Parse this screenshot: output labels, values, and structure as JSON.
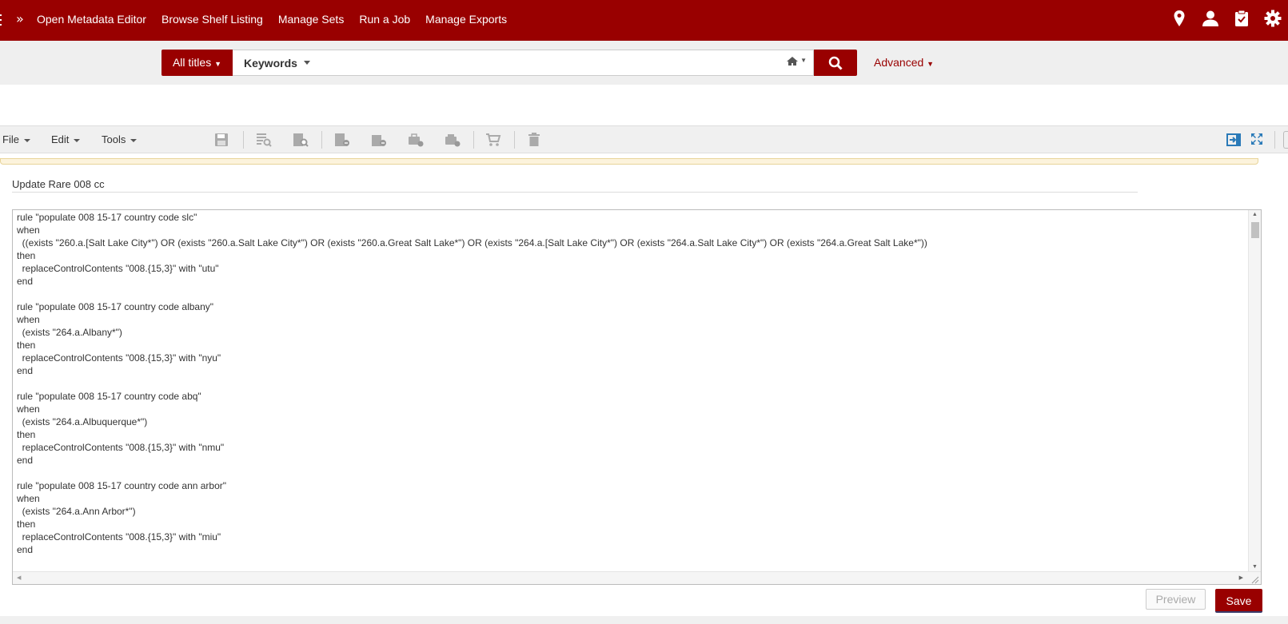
{
  "topnav": {
    "items": [
      "Open Metadata Editor",
      "Browse Shelf Listing",
      "Manage Sets",
      "Run a Job",
      "Manage Exports"
    ],
    "icons": [
      "location-icon",
      "user-icon",
      "clipboard-icon",
      "gear-icon"
    ]
  },
  "search": {
    "scope": "All titles",
    "field": "Keywords",
    "value": "",
    "advanced": "Advanced"
  },
  "toolbar": {
    "menus": [
      "File",
      "Edit",
      "Tools"
    ]
  },
  "rule": {
    "name": "Update Rare 008 cc",
    "code": "rule \"populate 008 15-17 country code slc\"\nwhen\n  ((exists \"260.a.[Salt Lake City*\") OR (exists \"260.a.Salt Lake City*\") OR (exists \"260.a.Great Salt Lake*\") OR (exists \"264.a.[Salt Lake City*\") OR (exists \"264.a.Salt Lake City*\") OR (exists \"264.a.Great Salt Lake*\"))\nthen\n  replaceControlContents \"008.{15,3}\" with \"utu\"\nend\n\nrule \"populate 008 15-17 country code albany\"\nwhen\n  (exists \"264.a.Albany*\")\nthen\n  replaceControlContents \"008.{15,3}\" with \"nyu\"\nend\n\nrule \"populate 008 15-17 country code abq\"\nwhen\n  (exists \"264.a.Albuquerque*\")\nthen\n  replaceControlContents \"008.{15,3}\" with \"nmu\"\nend\n\nrule \"populate 008 15-17 country code ann arbor\"\nwhen\n  (exists \"264.a.Ann Arbor*\")\nthen\n  replaceControlContents \"008.{15,3}\" with \"miu\"\nend\n\nrule \"populate 008 15-17 country code ..."
  },
  "footer": {
    "preview": "Preview",
    "save": "Save"
  },
  "colors": {
    "brand": "#990000",
    "notice_bg": "#fcf3dc",
    "icon_blue": "#2a7ab8"
  }
}
